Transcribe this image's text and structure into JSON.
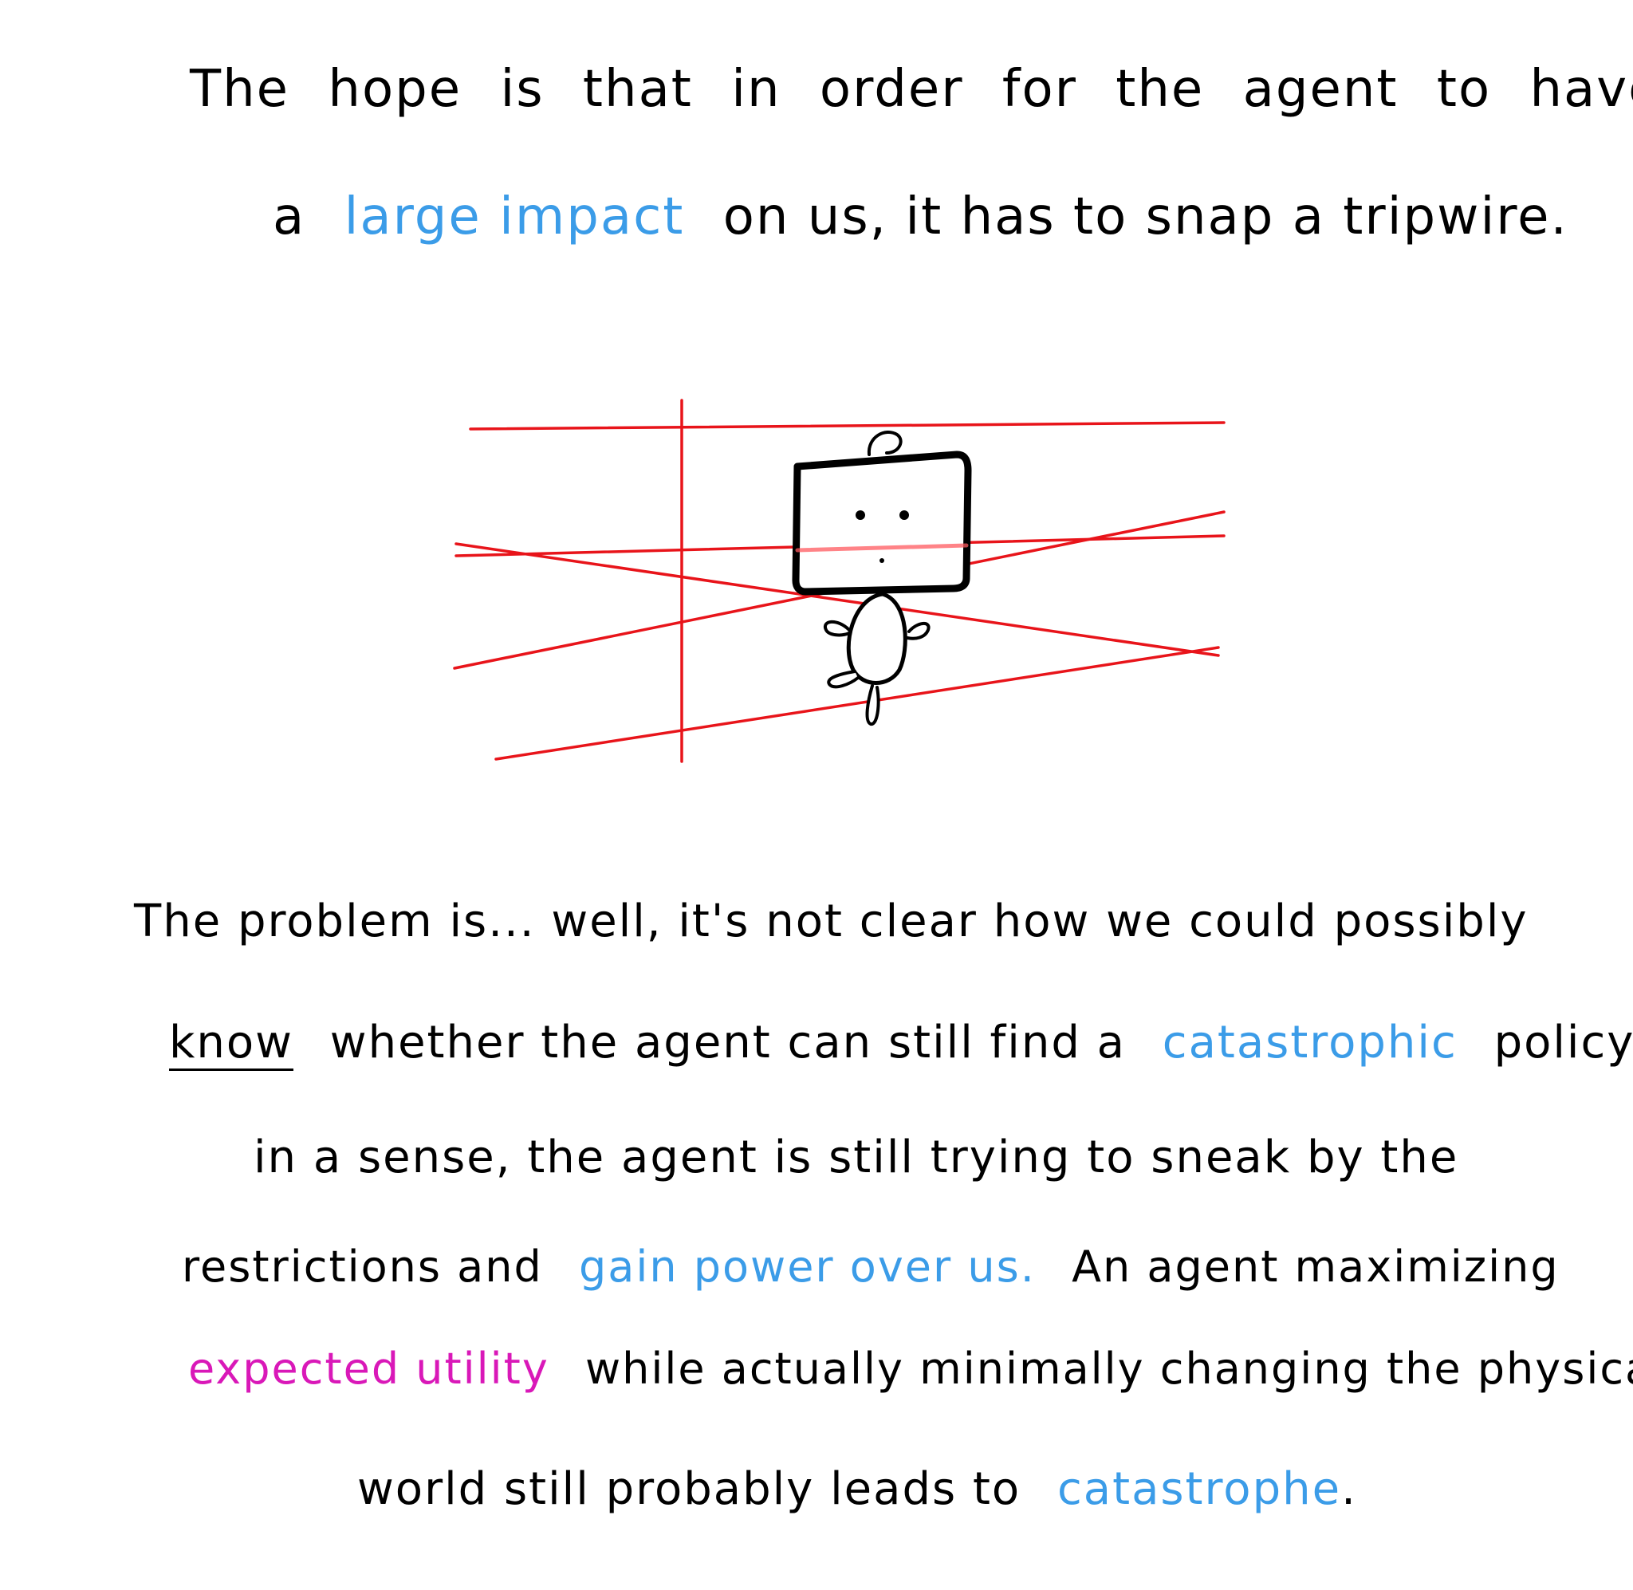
{
  "colors": {
    "ink": "#000000",
    "highlight_blue": "#3b9ce8",
    "highlight_magenta": "#d918b8",
    "tripwire_red": "#e8141a",
    "background": "#ffffff"
  },
  "caption_top": {
    "line1": [
      "The",
      "hope",
      "is",
      "that",
      "in",
      "order",
      "for",
      "the",
      "agent",
      "to",
      "have"
    ],
    "line2": {
      "lead": "a",
      "highlight": "large impact",
      "rest": "on us, it has to snap a tripwire."
    }
  },
  "illustration": {
    "subject": "robot-agent",
    "hazard": "tripwires"
  },
  "caption_bottom": {
    "line1": "The problem is... well, it's not clear how we could possibly",
    "line2": {
      "underlined": "know",
      "middle": "whether the agent can still find a",
      "highlight": "catastrophic",
      "rest": "policy;"
    },
    "line3": "in a sense, the agent is still trying to sneak by the",
    "line4": {
      "lead": "restrictions and",
      "highlight": "gain power over us.",
      "rest": "An agent maximizing"
    },
    "line5": {
      "highlight": "expected utility",
      "rest": "while actually minimally changing the physical"
    },
    "line6": {
      "lead": "world still probably leads to",
      "highlight": "catastrophe",
      "rest": "."
    }
  }
}
